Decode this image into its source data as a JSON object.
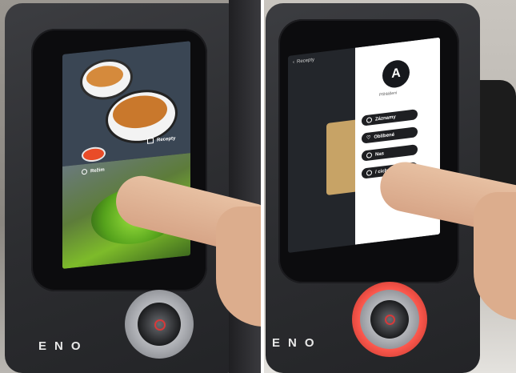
{
  "left_panel": {
    "screen": {
      "recepty_label": "Recepty",
      "rezim_label": "Režim"
    },
    "brand": "ENO"
  },
  "right_panel": {
    "header_back": "Recepty",
    "profile_label": "Přihlášení",
    "menu_items": [
      {
        "label": "Záznamy"
      },
      {
        "label": "Oblíbené"
      },
      {
        "label": "Nas"
      },
      {
        "label": "/ cichá"
      }
    ],
    "brand": "ENO"
  },
  "colors": {
    "device": "#2c2d30",
    "screen_bezel": "#0c0c0e",
    "ring_red": "#ff5a4f",
    "skin": "#e1b595"
  }
}
